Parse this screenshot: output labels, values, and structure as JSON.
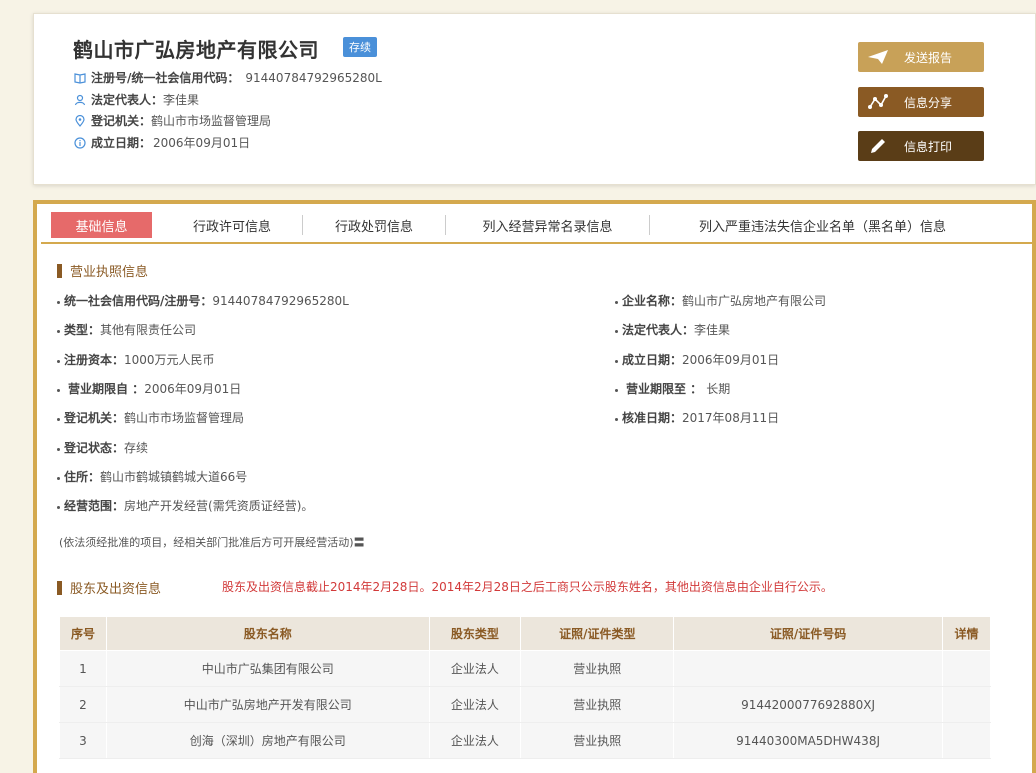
{
  "header": {
    "company_name": "鹤山市广弘房地产有限公司",
    "status": "存续",
    "credit_code_label": "注册号/统一社会信用代码：",
    "credit_code": "91440784792965280L",
    "legal_rep_label": "法定代表人：",
    "legal_rep": "李佳果",
    "authority_label": "登记机关：",
    "authority": "鹤山市市场监督管理局",
    "founded_label": "成立日期：",
    "founded": "2006年09月01日"
  },
  "actions": {
    "send_report": "发送报告",
    "share": "信息分享",
    "print": "信息打印"
  },
  "tabs": [
    {
      "label": "基础信息"
    },
    {
      "label": "行政许可信息"
    },
    {
      "label": "行政处罚信息"
    },
    {
      "label": "列入经营异常名录信息"
    },
    {
      "label": "列入严重违法失信企业名单（黑名单）信息"
    }
  ],
  "license": {
    "title": "营业执照信息",
    "fields": {
      "credit_code_label": "统一社会信用代码/注册号：",
      "credit_code": "91440784792965280L",
      "company_name_label": "企业名称：",
      "company_name": "鹤山市广弘房地产有限公司",
      "type_label": "类型：",
      "type": "其他有限责任公司",
      "legal_rep_label": "法定代表人：",
      "legal_rep": "李佳果",
      "capital_label": "注册资本：",
      "capital": "1000万元人民币",
      "founded_label": "成立日期：",
      "founded": "2006年09月01日",
      "term_from_label": "营业期限自 ：",
      "term_from": "2006年09月01日",
      "term_to_label": "营业期限至 ：",
      "term_to": "长期",
      "authority_label": "登记机关：",
      "authority": "鹤山市市场监督管理局",
      "approve_label": "核准日期：",
      "approve": "2017年08月11日",
      "status_label": "登记状态：",
      "status": "存续",
      "address_label": "住所：",
      "address": "鹤山市鹤城镇鹤城大道66号",
      "scope_label": "经营范围：",
      "scope": "房地产开发经营(需凭资质证经营)。"
    },
    "note": "(依法须经批准的项目，经相关部门批准后方可开展经营活动)〓"
  },
  "shareholders": {
    "title": "股东及出资信息",
    "notice": "股东及出资信息截止2014年2月28日。2014年2月28日之后工商只公示股东姓名，其他出资信息由企业自行公示。",
    "columns": [
      "序号",
      "股东名称",
      "股东类型",
      "证照/证件类型",
      "证照/证件号码",
      "详情"
    ],
    "rows": [
      [
        "1",
        "中山市广弘集团有限公司",
        "企业法人",
        "营业执照",
        "",
        ""
      ],
      [
        "2",
        "中山市广弘房地产开发有限公司",
        "企业法人",
        "营业执照",
        "9144200077692880XJ",
        ""
      ],
      [
        "3",
        "创海（深圳）房地产有限公司",
        "企业法人",
        "营业执照",
        "91440300MA5DHW438J",
        ""
      ]
    ]
  },
  "colors": {
    "accent": "#d4a94e",
    "brown": "#8a5a24",
    "dark_brown": "#5a3d17",
    "tab_active": "#e66a6a",
    "badge": "#4a90d9",
    "notice": "#d23a3a"
  }
}
